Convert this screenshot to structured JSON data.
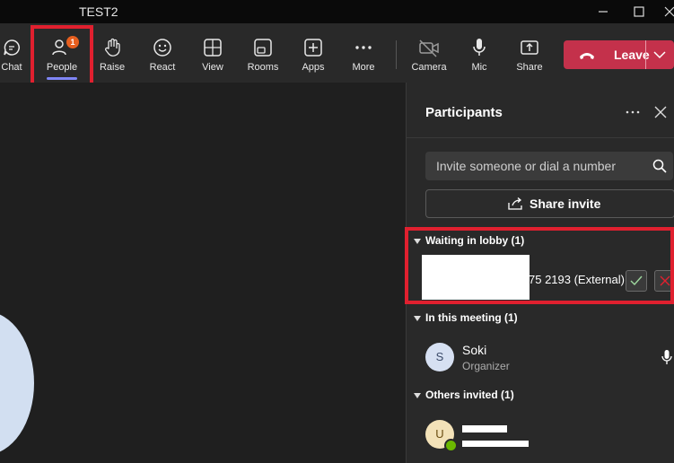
{
  "window": {
    "title": "TEST2"
  },
  "toolbar": {
    "chat": "Chat",
    "people": "People",
    "people_badge": "1",
    "raise": "Raise",
    "react": "React",
    "view": "View",
    "rooms": "Rooms",
    "apps": "Apps",
    "more": "More",
    "camera": "Camera",
    "mic": "Mic",
    "share": "Share",
    "leave": "Leave"
  },
  "panel": {
    "title": "Participants",
    "search_placeholder": "Invite someone or dial a number",
    "share_invite": "Share invite",
    "lobby": {
      "header": "Waiting in lobby (1)",
      "entry_text": "75 2193 (External)"
    },
    "in_meeting": {
      "header": "In this meeting (1)",
      "participants": [
        {
          "initial": "S",
          "name": "Soki",
          "role": "Organizer"
        }
      ]
    },
    "others_invited": {
      "header": "Others invited (1)",
      "participants": [
        {
          "initial": "U"
        }
      ]
    }
  },
  "colors": {
    "leave": "#c4314b",
    "highlight": "#e0202f",
    "accent_underline": "#7f85f5",
    "badge": "#e65f1f"
  }
}
